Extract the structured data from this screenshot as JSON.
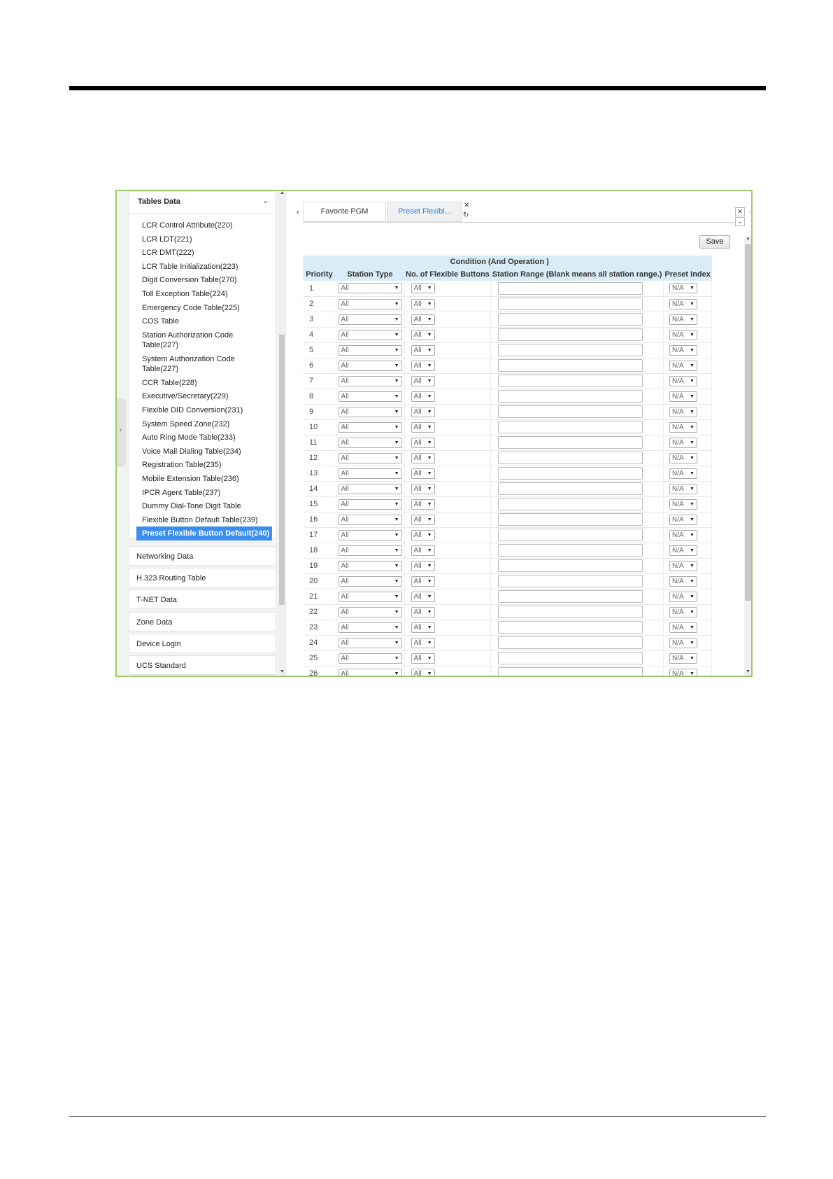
{
  "sidebar": {
    "section_title": "Tables Data",
    "items": [
      "LCR Control Attribute(220)",
      "LCR LDT(221)",
      "LCR DMT(222)",
      "LCR Table Initialization(223)",
      "Digit Conversion Table(270)",
      "Toll Exception Table(224)",
      "Emergency Code Table(225)",
      "COS Table",
      "Station Authorization Code Table(227)",
      "System Authorization Code Table(227)",
      "CCR Table(228)",
      "Executive/Secretary(229)",
      "Flexible DID Conversion(231)",
      "System Speed Zone(232)",
      "Auto Ring Mode Table(233)",
      "Voice Mail Dialing Table(234)",
      "Registration Table(235)",
      "Mobile Extension Table(236)",
      "IPCR Agent Table(237)",
      "Dummy Dial-Tone Digit Table",
      "Flexible Button Default Table(239)",
      "Preset Flexible Button Default(240)"
    ],
    "selected_index": 21,
    "categories": [
      "Networking Data",
      "H.323 Routing Table",
      "T-NET Data",
      "Zone Data",
      "Device Login",
      "UCS Standard"
    ]
  },
  "tabs": [
    {
      "label": "Favorite PGM",
      "active": false
    },
    {
      "label": "Preset Flexibl...",
      "active": true
    }
  ],
  "toolbar": {
    "save_label": "Save"
  },
  "table": {
    "group_header": "Condition (And Operation )",
    "columns": [
      "Priority",
      "Station Type",
      "No. of Flexible Buttons",
      "Station Range (Blank means all station range.)",
      "Preset Index"
    ],
    "rows": [
      {
        "priority": "1",
        "station_type": "All",
        "buttons": "All",
        "station_range": "",
        "preset_index": "N/A"
      },
      {
        "priority": "2",
        "station_type": "All",
        "buttons": "All",
        "station_range": "",
        "preset_index": "N/A"
      },
      {
        "priority": "3",
        "station_type": "All",
        "buttons": "All",
        "station_range": "",
        "preset_index": "N/A"
      },
      {
        "priority": "4",
        "station_type": "All",
        "buttons": "All",
        "station_range": "",
        "preset_index": "N/A"
      },
      {
        "priority": "5",
        "station_type": "All",
        "buttons": "All",
        "station_range": "",
        "preset_index": "N/A"
      },
      {
        "priority": "6",
        "station_type": "All",
        "buttons": "All",
        "station_range": "",
        "preset_index": "N/A"
      },
      {
        "priority": "7",
        "station_type": "All",
        "buttons": "All",
        "station_range": "",
        "preset_index": "N/A"
      },
      {
        "priority": "8",
        "station_type": "All",
        "buttons": "All",
        "station_range": "",
        "preset_index": "N/A"
      },
      {
        "priority": "9",
        "station_type": "All",
        "buttons": "All",
        "station_range": "",
        "preset_index": "N/A"
      },
      {
        "priority": "10",
        "station_type": "All",
        "buttons": "All",
        "station_range": "",
        "preset_index": "N/A"
      },
      {
        "priority": "11",
        "station_type": "All",
        "buttons": "All",
        "station_range": "",
        "preset_index": "N/A"
      },
      {
        "priority": "12",
        "station_type": "All",
        "buttons": "All",
        "station_range": "",
        "preset_index": "N/A"
      },
      {
        "priority": "13",
        "station_type": "All",
        "buttons": "All",
        "station_range": "",
        "preset_index": "N/A"
      },
      {
        "priority": "14",
        "station_type": "All",
        "buttons": "All",
        "station_range": "",
        "preset_index": "N/A"
      },
      {
        "priority": "15",
        "station_type": "All",
        "buttons": "All",
        "station_range": "",
        "preset_index": "N/A"
      },
      {
        "priority": "16",
        "station_type": "All",
        "buttons": "All",
        "station_range": "",
        "preset_index": "N/A"
      },
      {
        "priority": "17",
        "station_type": "All",
        "buttons": "All",
        "station_range": "",
        "preset_index": "N/A"
      },
      {
        "priority": "18",
        "station_type": "All",
        "buttons": "All",
        "station_range": "",
        "preset_index": "N/A"
      },
      {
        "priority": "19",
        "station_type": "All",
        "buttons": "All",
        "station_range": "",
        "preset_index": "N/A"
      },
      {
        "priority": "20",
        "station_type": "All",
        "buttons": "All",
        "station_range": "",
        "preset_index": "N/A"
      },
      {
        "priority": "21",
        "station_type": "All",
        "buttons": "All",
        "station_range": "",
        "preset_index": "N/A"
      },
      {
        "priority": "22",
        "station_type": "All",
        "buttons": "All",
        "station_range": "",
        "preset_index": "N/A"
      },
      {
        "priority": "23",
        "station_type": "All",
        "buttons": "All",
        "station_range": "",
        "preset_index": "N/A"
      },
      {
        "priority": "24",
        "station_type": "All",
        "buttons": "All",
        "station_range": "",
        "preset_index": "N/A"
      },
      {
        "priority": "25",
        "station_type": "All",
        "buttons": "All",
        "station_range": "",
        "preset_index": "N/A"
      },
      {
        "priority": "26",
        "station_type": "All",
        "buttons": "All",
        "station_range": "",
        "preset_index": "N/A"
      }
    ]
  },
  "colors": {
    "accent": "#3b8ef0",
    "frame": "#9ccc6a",
    "header_bg": "#d9ecf7"
  }
}
